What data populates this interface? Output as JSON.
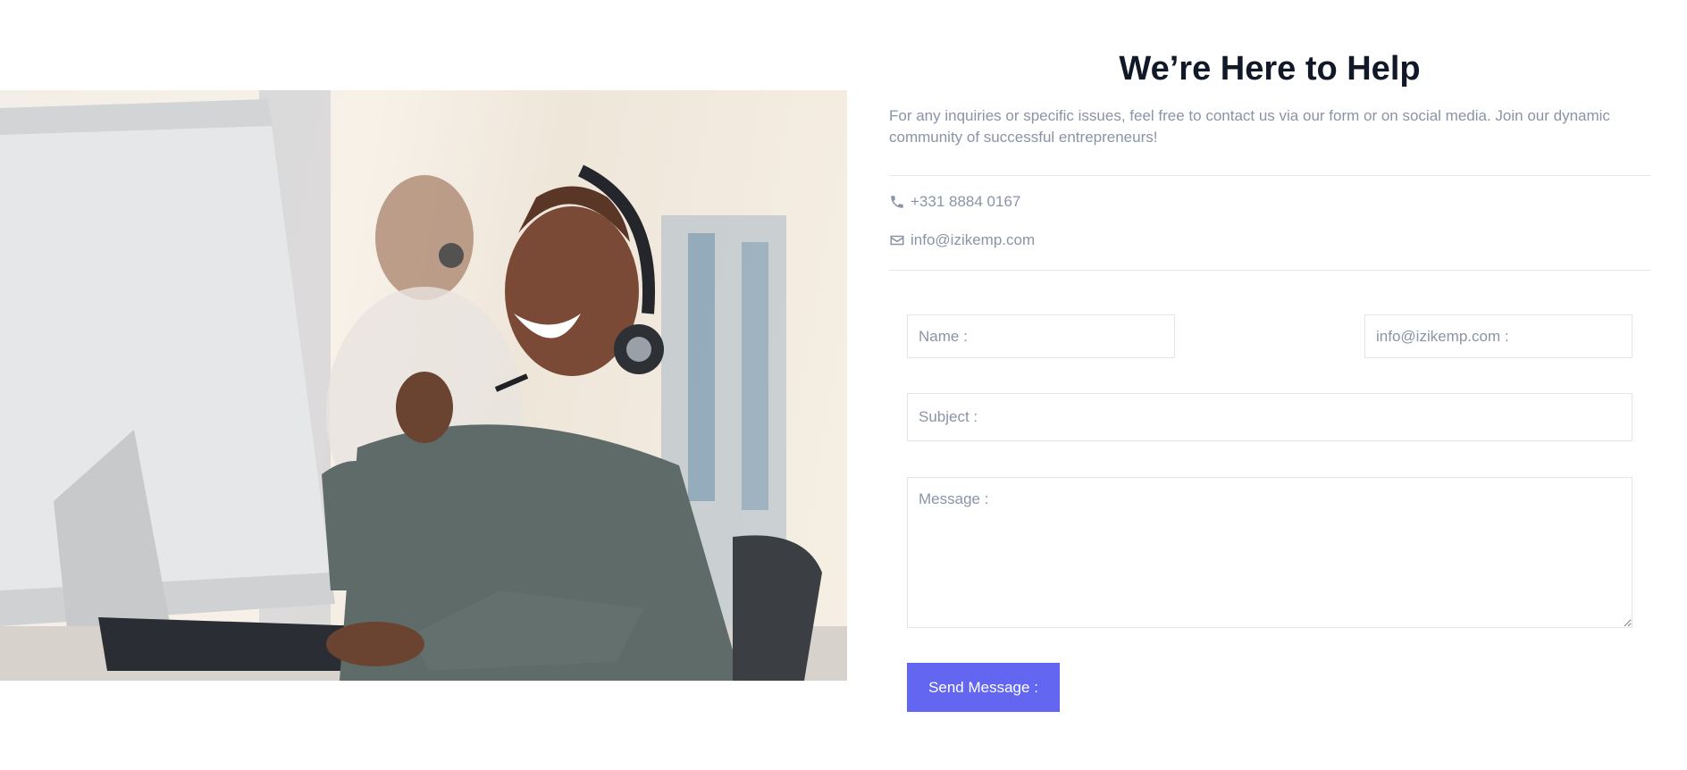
{
  "photo": {
    "alt": "Smiling customer support agent wearing a headset working at a computer"
  },
  "contact": {
    "heading": "We’re Here to Help",
    "intro": "For any inquiries or specific issues, feel free to contact us via our form or on social media. Join our dynamic community of successful entrepreneurs!",
    "phone": "+331 8884 0167",
    "phone_icon": "phone-icon",
    "email": "info@izikemp.com",
    "email_icon": "envelope-icon"
  },
  "form": {
    "name_placeholder": "Name :",
    "email_placeholder": "info@izikemp.com :",
    "subject_placeholder": "Subject :",
    "message_placeholder": "Message :",
    "submit_label": "Send Message :"
  },
  "colors": {
    "accent": "#6366f1",
    "heading": "#111827",
    "muted": "#8a94a6"
  }
}
